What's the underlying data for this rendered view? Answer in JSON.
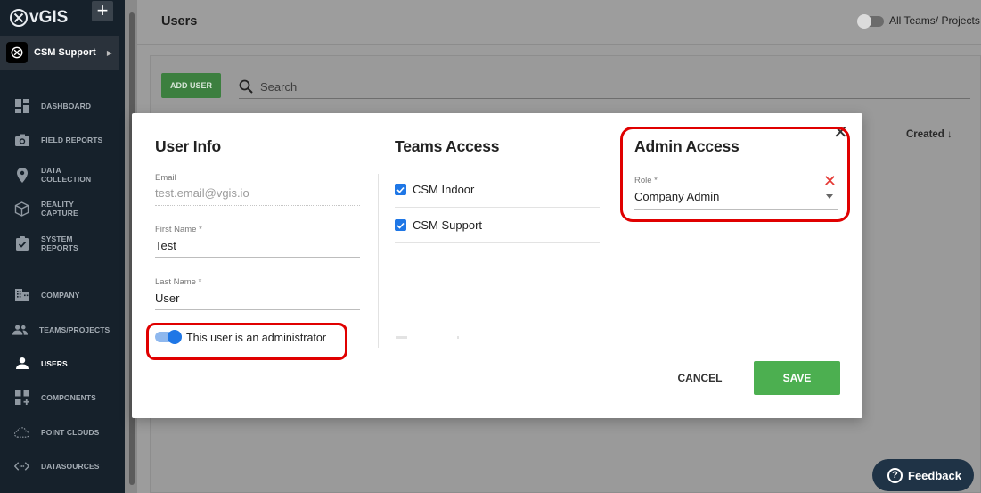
{
  "app": {
    "logo_text": "vGIS",
    "add_label": "+"
  },
  "team": {
    "name": "CSM Support"
  },
  "sidebar": {
    "items": [
      {
        "label": "DASHBOARD",
        "icon": "dashboard-icon",
        "active": false
      },
      {
        "label": "FIELD REPORTS",
        "icon": "camera-icon",
        "active": false
      },
      {
        "label": "DATA\nCOLLECTION",
        "icon": "location-pin-icon",
        "active": false
      },
      {
        "label": "REALITY\nCAPTURE",
        "icon": "cube-icon",
        "active": false
      },
      {
        "label": "SYSTEM\nREPORTS",
        "icon": "clipboard-check-icon",
        "active": false
      },
      {
        "label": "COMPANY",
        "icon": "building-icon",
        "active": false
      },
      {
        "label": "TEAMS/PROJECTS",
        "icon": "people-icon",
        "active": false
      },
      {
        "label": "USERS",
        "icon": "person-icon",
        "active": true
      },
      {
        "label": "COMPONENTS",
        "icon": "components-icon",
        "active": false
      },
      {
        "label": "POINT CLOUDS",
        "icon": "cloud-icon",
        "active": false
      },
      {
        "label": "DATASOURCES",
        "icon": "code-arrows-icon",
        "active": false
      }
    ]
  },
  "header": {
    "title": "Users",
    "toggle_label": "All Teams/ Projects",
    "toggle_on": false
  },
  "toolbar": {
    "add_user_label": "ADD USER",
    "search_placeholder": "Search"
  },
  "table": {
    "created_header": "Created"
  },
  "modal": {
    "user_info": {
      "title": "User Info",
      "email_label": "Email",
      "email_value": "test.email@vgis.io",
      "first_name_label": "First Name *",
      "first_name_value": "Test",
      "last_name_label": "Last Name *",
      "last_name_value": "User",
      "admin_toggle_label": "This user is an administrator",
      "admin_toggle_on": true
    },
    "teams_access": {
      "title": "Teams Access",
      "teams": [
        {
          "label": "CSM Indoor",
          "checked": true
        },
        {
          "label": "CSM Support",
          "checked": true
        }
      ]
    },
    "admin_access": {
      "title": "Admin Access",
      "role_label": "Role *",
      "role_value": "Company Admin"
    },
    "cancel_label": "CANCEL",
    "save_label": "SAVE"
  },
  "feedback": {
    "label": "Feedback"
  },
  "colors": {
    "accent_blue": "#1f77e6",
    "save_green": "#4caf50",
    "highlight_red": "#e00000",
    "sidebar_bg": "#16212b"
  }
}
